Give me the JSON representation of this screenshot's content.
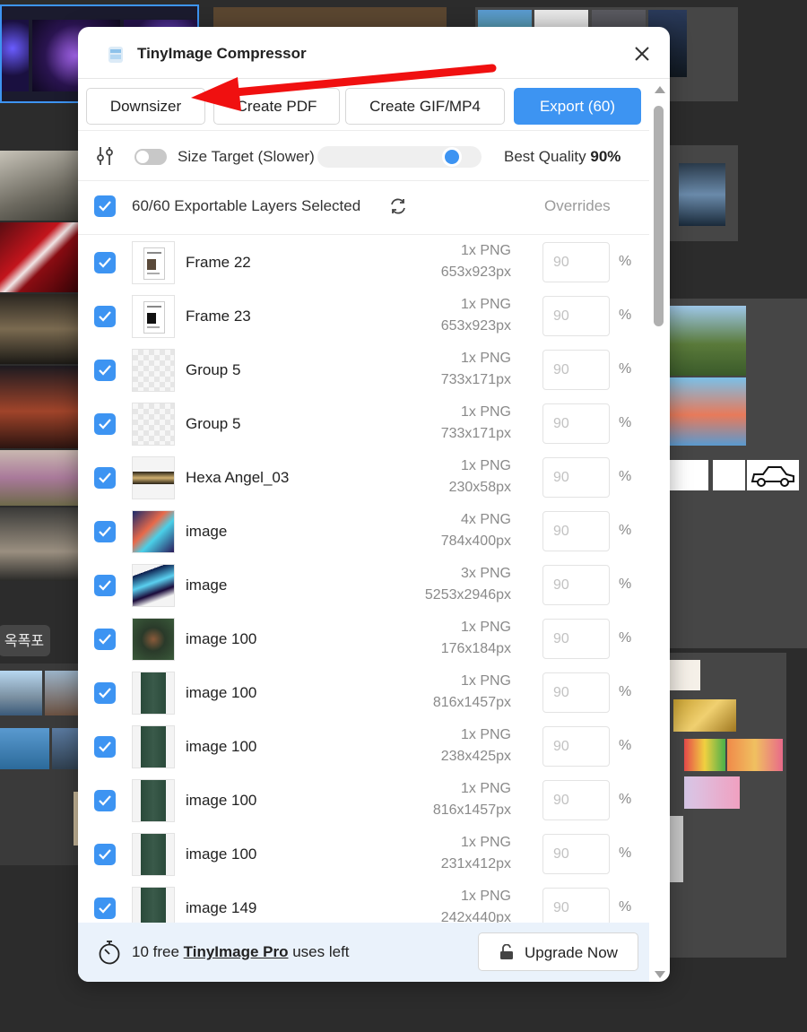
{
  "app": {
    "title": "TinyImage Compressor",
    "accent": "#3d94f2"
  },
  "canvas": {
    "korean_label": "옥폭포"
  },
  "toolbar": {
    "downsizer_label": "Downsizer",
    "pdf_label": "Create PDF",
    "gif_label": "Create GIF/MP4",
    "export_label": "Export (60)"
  },
  "settings": {
    "size_target_label": "Size Target (Slower)",
    "size_target_enabled": false,
    "best_quality_label": "Best Quality",
    "quality_value": "90%",
    "quality_slider_fraction": 0.9
  },
  "selection": {
    "label": "60/60 Exportable Layers Selected",
    "overrides_label": "Overrides"
  },
  "layers": [
    {
      "name": "Frame 22",
      "format": "1x PNG",
      "dims": "653x923px",
      "placeholder": "90",
      "thumb": "doc"
    },
    {
      "name": "Frame 23",
      "format": "1x PNG",
      "dims": "653x923px",
      "placeholder": "90",
      "thumb": "doc-dark"
    },
    {
      "name": "Group 5",
      "format": "1x PNG",
      "dims": "733x171px",
      "placeholder": "90",
      "thumb": "transparent"
    },
    {
      "name": "Group 5",
      "format": "1x PNG",
      "dims": "733x171px",
      "placeholder": "90",
      "thumb": "transparent"
    },
    {
      "name": "Hexa Angel_03",
      "format": "1x PNG",
      "dims": "230x58px",
      "placeholder": "90",
      "thumb": "banner"
    },
    {
      "name": "image",
      "format": "4x PNG",
      "dims": "784x400px",
      "placeholder": "90",
      "thumb": "colorful"
    },
    {
      "name": "image",
      "format": "3x PNG",
      "dims": "5253x2946px",
      "placeholder": "90",
      "thumb": "aurora"
    },
    {
      "name": "image 100",
      "format": "1x PNG",
      "dims": "176x184px",
      "placeholder": "90",
      "thumb": "portrait"
    },
    {
      "name": "image 100",
      "format": "1x PNG",
      "dims": "816x1457px",
      "placeholder": "90",
      "thumb": "portrait-tall"
    },
    {
      "name": "image 100",
      "format": "1x PNG",
      "dims": "238x425px",
      "placeholder": "90",
      "thumb": "portrait-tall"
    },
    {
      "name": "image 100",
      "format": "1x PNG",
      "dims": "816x1457px",
      "placeholder": "90",
      "thumb": "portrait-tall"
    },
    {
      "name": "image 100",
      "format": "1x PNG",
      "dims": "231x412px",
      "placeholder": "90",
      "thumb": "portrait-tall"
    },
    {
      "name": "image 149",
      "format": "1x PNG",
      "dims": "242x440px",
      "placeholder": "90",
      "thumb": "portrait-tall"
    }
  ],
  "percent_symbol": "%",
  "footer": {
    "prefix": "10 free ",
    "pro_link": "TinyImage Pro",
    "suffix": " uses left",
    "upgrade_label": "Upgrade Now"
  }
}
